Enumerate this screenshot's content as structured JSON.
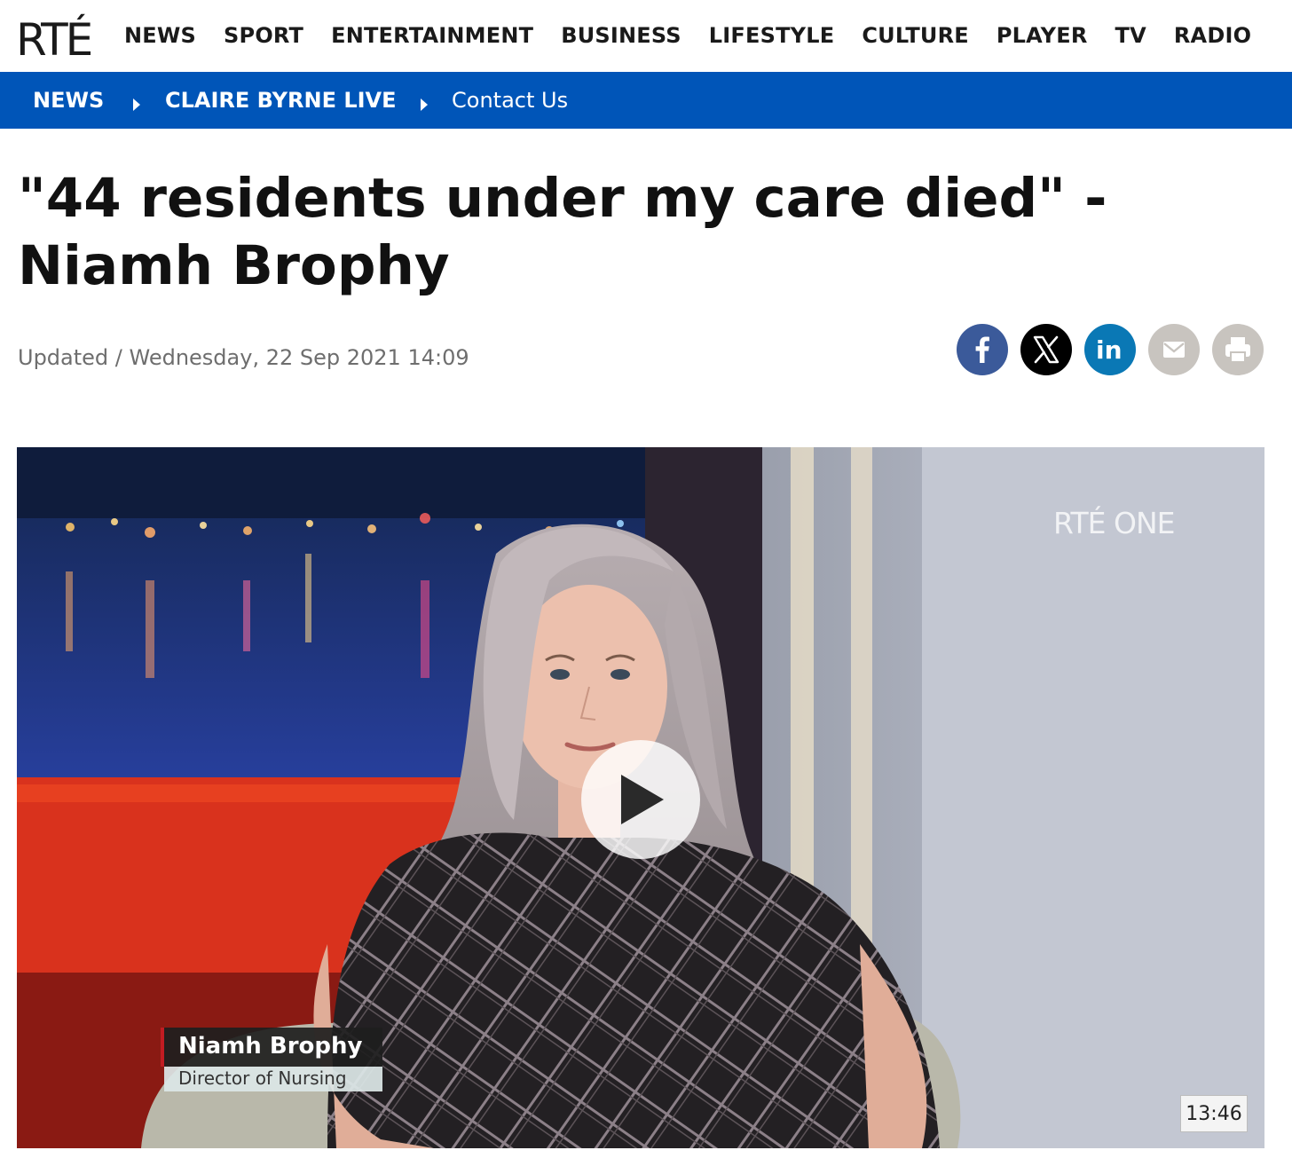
{
  "brand": {
    "logo_text": "RTÉ",
    "accent_color": "#0055b8"
  },
  "topnav": {
    "items": [
      "NEWS",
      "SPORT",
      "ENTERTAINMENT",
      "BUSINESS",
      "LIFESTYLE",
      "CULTURE",
      "PLAYER",
      "TV",
      "RADIO"
    ]
  },
  "breadcrumb": {
    "items": [
      "NEWS",
      "CLAIRE BYRNE LIVE",
      "Contact Us"
    ]
  },
  "article": {
    "headline": "\"44 residents under my care died\" - Niamh Brophy",
    "dateline": "Updated / Wednesday, 22 Sep 2021 14:09"
  },
  "share": {
    "icons": [
      "facebook-icon",
      "x-icon",
      "linkedin-icon",
      "email-icon",
      "print-icon"
    ],
    "colors": {
      "facebook": "#3b5a9a",
      "x": "#000000",
      "linkedin": "#0a78b5",
      "email": "#c8c4bf",
      "print": "#c8c4bf"
    }
  },
  "video": {
    "watermark": "RTÉ ONE",
    "caption_name": "Niamh Brophy",
    "caption_role": "Director of Nursing",
    "duration": "13:46",
    "play_icon": "play-icon"
  }
}
